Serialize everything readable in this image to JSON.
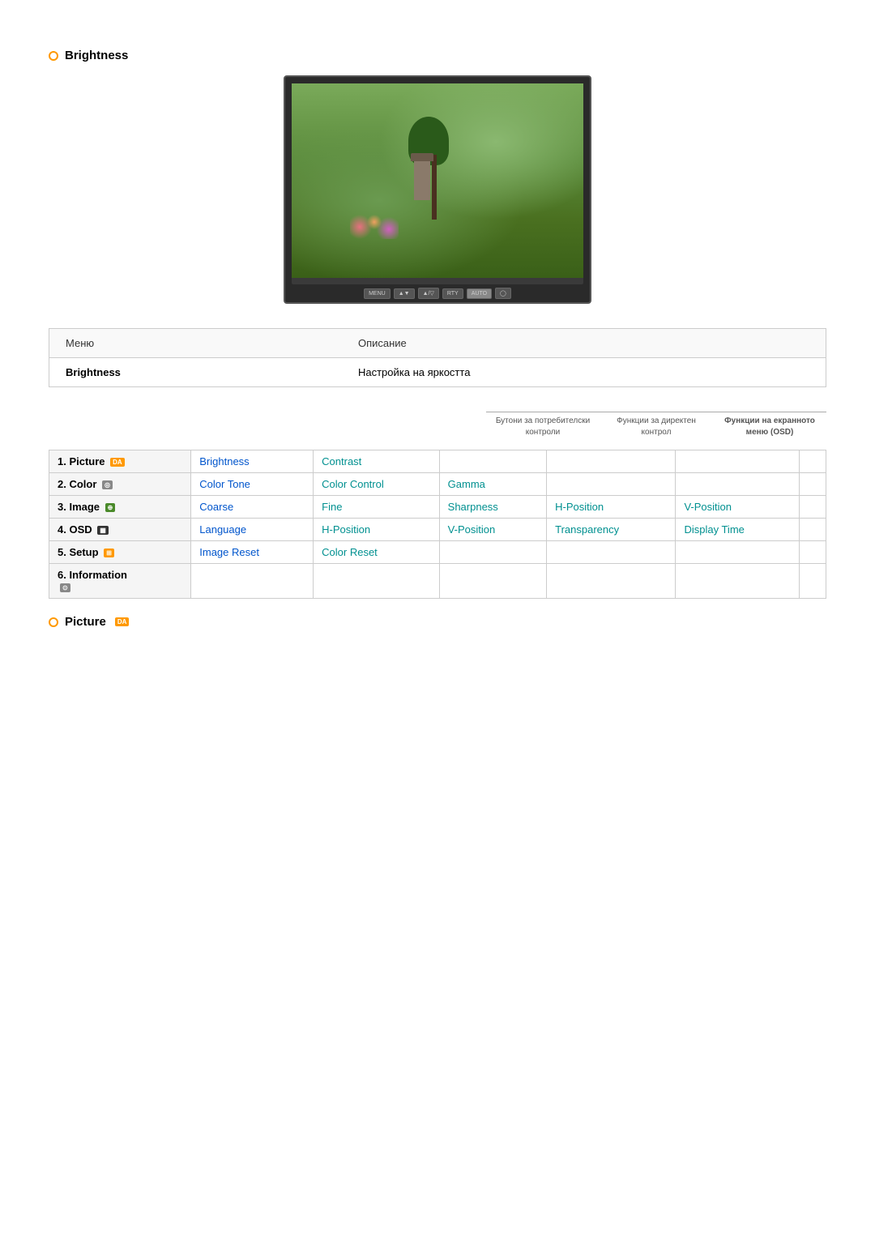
{
  "brightness_title": "Brightness",
  "monitor": {
    "controls": [
      "MENU",
      "▲▼",
      "▲/▽",
      "RTY",
      "AUTO",
      "◯"
    ]
  },
  "info_table": {
    "col1_header": "Меню",
    "col2_header": "Описание",
    "row1_col1": "Brightness",
    "row1_col2": "Настройка на яркостта"
  },
  "button_functions": {
    "col1": "Бутони за потребителски контроли",
    "col2": "Функции за директен контрол",
    "col3": "Функции на екранното меню (OSD)"
  },
  "menu_grid": {
    "rows": [
      {
        "menu": "1. Picture",
        "menu_badge": "DA",
        "cols": [
          "Brightness",
          "Contrast",
          "",
          "",
          "",
          ""
        ]
      },
      {
        "menu": "2. Color",
        "menu_badge": "◎",
        "cols": [
          "Color Tone",
          "Color Control",
          "Gamma",
          "",
          "",
          ""
        ]
      },
      {
        "menu": "3. Image",
        "menu_badge": "⊕",
        "cols": [
          "Coarse",
          "Fine",
          "Sharpness",
          "H-Position",
          "V-Position",
          ""
        ]
      },
      {
        "menu": "4. OSD",
        "menu_badge": "▦",
        "cols": [
          "Language",
          "H-Position",
          "V-Position",
          "Transparency",
          "Display Time",
          ""
        ]
      },
      {
        "menu": "5. Setup",
        "menu_badge": "⊞",
        "cols": [
          "Image Reset",
          "Color Reset",
          "",
          "",
          "",
          ""
        ]
      },
      {
        "menu": "6. Information",
        "menu_badge": "⊙",
        "cols": [
          "",
          "",
          "",
          "",
          "",
          ""
        ]
      }
    ]
  },
  "picture_label": "Picture",
  "picture_badge": "DA"
}
